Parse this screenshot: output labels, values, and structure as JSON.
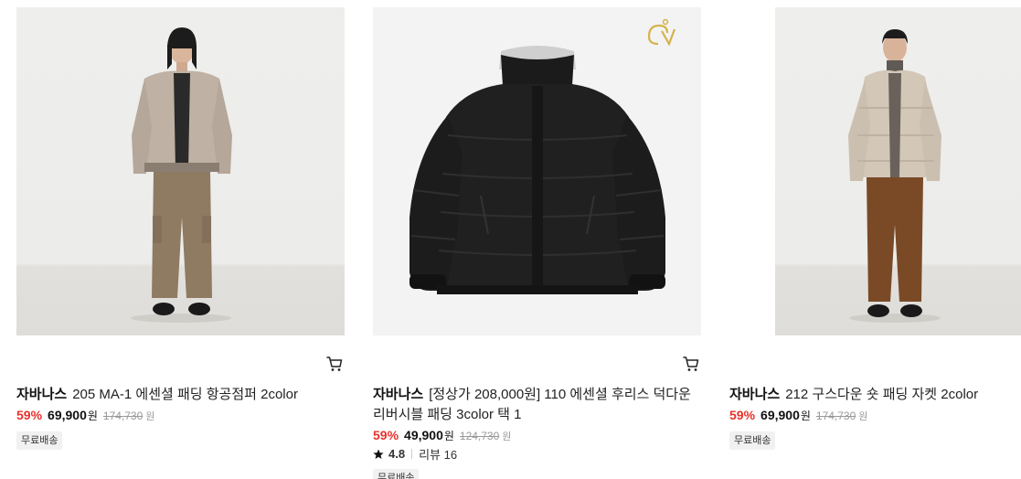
{
  "products": [
    {
      "brand": "자바나스",
      "name": "205 MA-1 에센셜 패딩 항공점퍼 2color",
      "discount": "59%",
      "price": "69,900",
      "price_unit": "원",
      "original_price": "174,730",
      "original_unit": "원",
      "badge": "무료배송"
    },
    {
      "brand": "자바나스",
      "name": "[정상가 208,000원] 110 에센셜 후리스 덕다운 리버시블 패딩 3color 택 1",
      "discount": "59%",
      "price": "49,900",
      "price_unit": "원",
      "original_price": "124,730",
      "original_unit": "원",
      "rating": "4.8",
      "reviews": "리뷰 16",
      "badge": "무료배송"
    },
    {
      "brand": "자바나스",
      "name": "212 구스다운 숏 패딩 자켓 2color",
      "discount": "59%",
      "price": "69,900",
      "price_unit": "원",
      "original_price": "174,730",
      "original_unit": "원",
      "badge": "무료배송"
    }
  ]
}
